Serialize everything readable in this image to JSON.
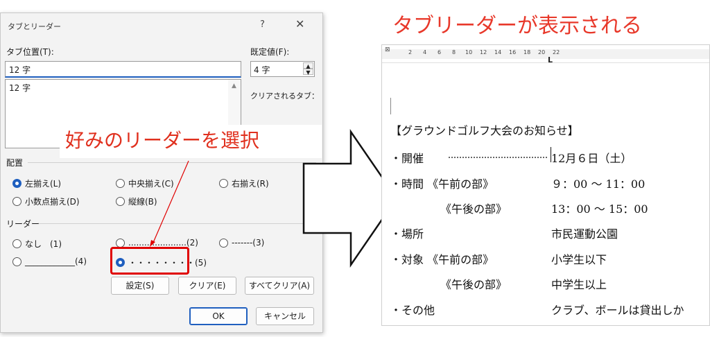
{
  "dialog": {
    "title": "タブとリーダー",
    "help": "?",
    "close": "✕",
    "tab_position_label": "タブ位置(T):",
    "tab_position_value": "12 字",
    "tab_list": [
      "12 字"
    ],
    "default_label": "既定値(F):",
    "default_value": "4 字",
    "clear_tabs_label": "クリアされるタブ：",
    "alignment_label": "配置",
    "alignment": [
      {
        "label": "左揃え(L)",
        "selected": true
      },
      {
        "label": "中央揃え(C)",
        "selected": false
      },
      {
        "label": "右揃え(R)",
        "selected": false
      },
      {
        "label": "小数点揃え(D)",
        "selected": false
      },
      {
        "label": "縦線(B)",
        "selected": false
      }
    ],
    "leader_label": "リーダー",
    "leaders": [
      {
        "label": "なし　(1)",
        "selected": false
      },
      {
        "label": "......................(2)",
        "selected": false
      },
      {
        "label": "-------(3)",
        "selected": false
      },
      {
        "label": "____________(4)",
        "selected": false
      },
      {
        "label": "・・・・・・・・(5)",
        "selected": true
      }
    ],
    "buttons": {
      "set": "設定(S)",
      "clear": "クリア(E)",
      "clear_all": "すべてクリア(A)",
      "ok": "OK",
      "cancel": "キャンセル"
    }
  },
  "callout": "好みのリーダーを選択",
  "heading": "タブリーダーが表示される",
  "ruler": {
    "numbers": [
      "2",
      "4",
      "6",
      "8",
      "10",
      "12",
      "14",
      "16",
      "18",
      "20",
      "22"
    ]
  },
  "document": {
    "lines": [
      "【グラウンドゴルフ大会のお知らせ】",
      "・開催",
      "12月６日（土）",
      "・時間 《午前の部》",
      "９：00 ～ 11：00",
      "《午後の部》",
      "13：00 ～ 15：00",
      "・場所",
      "市民運動公園",
      "・対象 《午前の部》",
      "小学生以下",
      "《午後の部》",
      "中学生以上",
      "・その他",
      "クラブ、ボールは貸出しか"
    ]
  },
  "colors": {
    "accent": "#1f5fbf",
    "highlight": "#e00000",
    "annotation": "#e8382a"
  }
}
